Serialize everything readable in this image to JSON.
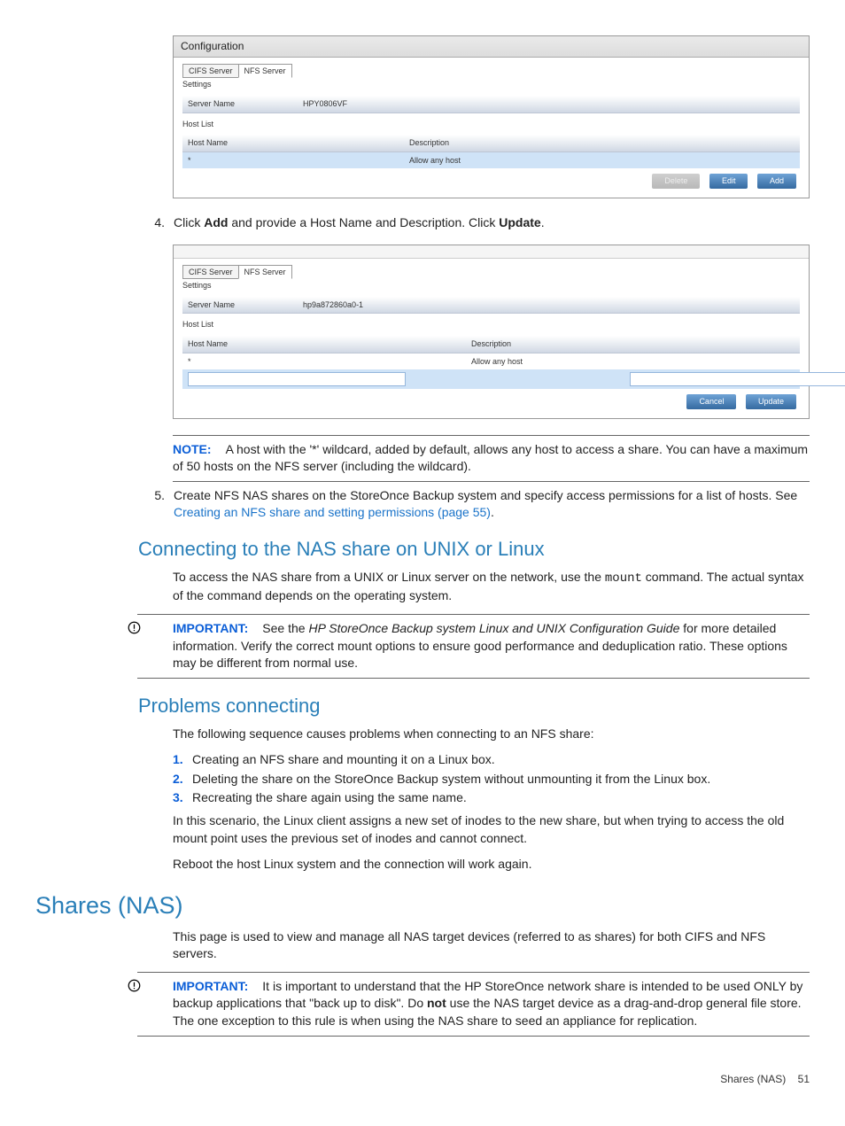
{
  "shot1": {
    "title": "Configuration",
    "tab1": "CIFS Server",
    "tab2": "NFS Server",
    "settings": "Settings",
    "sn_label": "Server Name",
    "sn_value": "HPY0806VF",
    "hostlist": "Host List",
    "col_hn": "Host Name",
    "col_desc": "Description",
    "row_hn": "*",
    "row_desc": "Allow any host",
    "btn_delete": "Delete",
    "btn_edit": "Edit",
    "btn_add": "Add"
  },
  "step4": {
    "num": "4.",
    "text_a": "Click ",
    "bold_add": "Add",
    "text_b": " and provide a Host Name and Description. Click ",
    "bold_update": "Update",
    "text_c": "."
  },
  "shot2": {
    "tab1": "CIFS Server",
    "tab2": "NFS Server",
    "settings": "Settings",
    "sn_label": "Server Name",
    "sn_value": "hp9a872860a0-1",
    "hostlist": "Host List",
    "col_hn": "Host Name",
    "col_desc": "Description",
    "row_hn": "*",
    "row_desc": "Allow any host",
    "btn_cancel": "Cancel",
    "btn_update": "Update"
  },
  "note": {
    "label": "NOTE:",
    "text": "A host with the '*' wildcard, added by default, allows any host to access a share. You can have a maximum of 50 hosts on the NFS server (including the wildcard)."
  },
  "step5": {
    "num": "5.",
    "text_a": "Create NFS NAS shares on the StoreOnce Backup system and specify access permissions for a list of hosts. See ",
    "link": "Creating an NFS share and setting permissions (page 55)",
    "text_b": "."
  },
  "connect": {
    "heading": "Connecting to the NAS share on UNIX or Linux",
    "para_a": "To access the NAS share from a UNIX or Linux server on the network, use the ",
    "mono": "mount",
    "para_b": " command. The actual syntax of the command depends on the operating system."
  },
  "important1": {
    "label": "IMPORTANT:",
    "text_a": "See the ",
    "italic": "HP StoreOnce Backup system Linux and UNIX Configuration Guide",
    "text_b": " for more detailed information. Verify the correct mount options to ensure good performance and deduplication ratio. These options may be different from normal use."
  },
  "problems": {
    "heading": "Problems connecting",
    "intro": "The following sequence causes problems when connecting to an NFS share:",
    "s1n": "1.",
    "s1": "Creating an NFS share and mounting it on a Linux box.",
    "s2n": "2.",
    "s2": "Deleting the share on the StoreOnce Backup system without unmounting it from the Linux box.",
    "s3n": "3.",
    "s3": "Recreating the share again using the same name.",
    "p2": "In this scenario, the Linux client assigns a new set of inodes to the new share, but when trying to access the old mount point uses the previous set of inodes and cannot connect.",
    "p3": "Reboot the host Linux system and the connection will work again."
  },
  "shares": {
    "heading": "Shares (NAS)",
    "intro": "This page is used to view and manage all NAS target devices (referred to as shares) for both CIFS and NFS servers."
  },
  "important2": {
    "label": "IMPORTANT:",
    "text_a": "It is important to understand that the HP StoreOnce network share is intended to be used ONLY by backup applications that \"back up to disk\". Do ",
    "bold": "not",
    "text_b": " use the NAS target device as a drag-and-drop general file store. The one exception to this rule is when using the NAS share to seed an appliance for replication."
  },
  "footer": {
    "text": "Shares (NAS)",
    "page": "51"
  }
}
